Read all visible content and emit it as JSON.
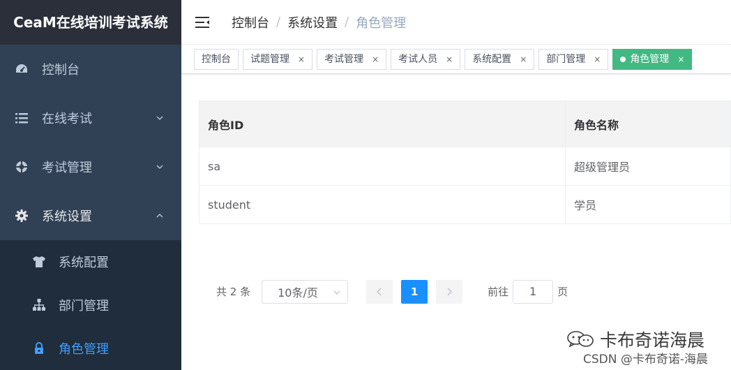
{
  "brand": "CeaM在线培训考试系统",
  "sidebar": {
    "items": [
      {
        "label": "控制台",
        "icon": "dashboard-icon"
      },
      {
        "label": "在线考试",
        "icon": "list-icon"
      },
      {
        "label": "考试管理",
        "icon": "target-icon"
      },
      {
        "label": "系统设置",
        "icon": "gear-icon"
      }
    ],
    "subitems": [
      {
        "label": "系统配置",
        "icon": "tshirt-icon"
      },
      {
        "label": "部门管理",
        "icon": "org-tree-icon"
      },
      {
        "label": "角色管理",
        "icon": "lock-icon"
      }
    ]
  },
  "breadcrumb": [
    "控制台",
    "系统设置",
    "角色管理"
  ],
  "tags": [
    {
      "label": "控制台",
      "closable": false
    },
    {
      "label": "试题管理"
    },
    {
      "label": "考试管理"
    },
    {
      "label": "考试人员"
    },
    {
      "label": "系统配置"
    },
    {
      "label": "部门管理"
    },
    {
      "label": "角色管理",
      "active": true
    }
  ],
  "table": {
    "headers": [
      "角色ID",
      "角色名称"
    ],
    "rows": [
      [
        "sa",
        "超级管理员"
      ],
      [
        "student",
        "学员"
      ]
    ]
  },
  "pagination": {
    "total": "共 2 条",
    "page_size": "10条/页",
    "current_page": "1",
    "goto_label": "前往",
    "goto_value": "1",
    "page_unit": "页"
  },
  "watermark": {
    "line1": "卡布奇诺海晨",
    "line2": "CSDN @卡布奇诺-海晨"
  },
  "colors": {
    "sidebar_bg": "#304156",
    "active_menu": "#409eff",
    "active_tag": "#42b983",
    "page_active": "#1890ff"
  }
}
